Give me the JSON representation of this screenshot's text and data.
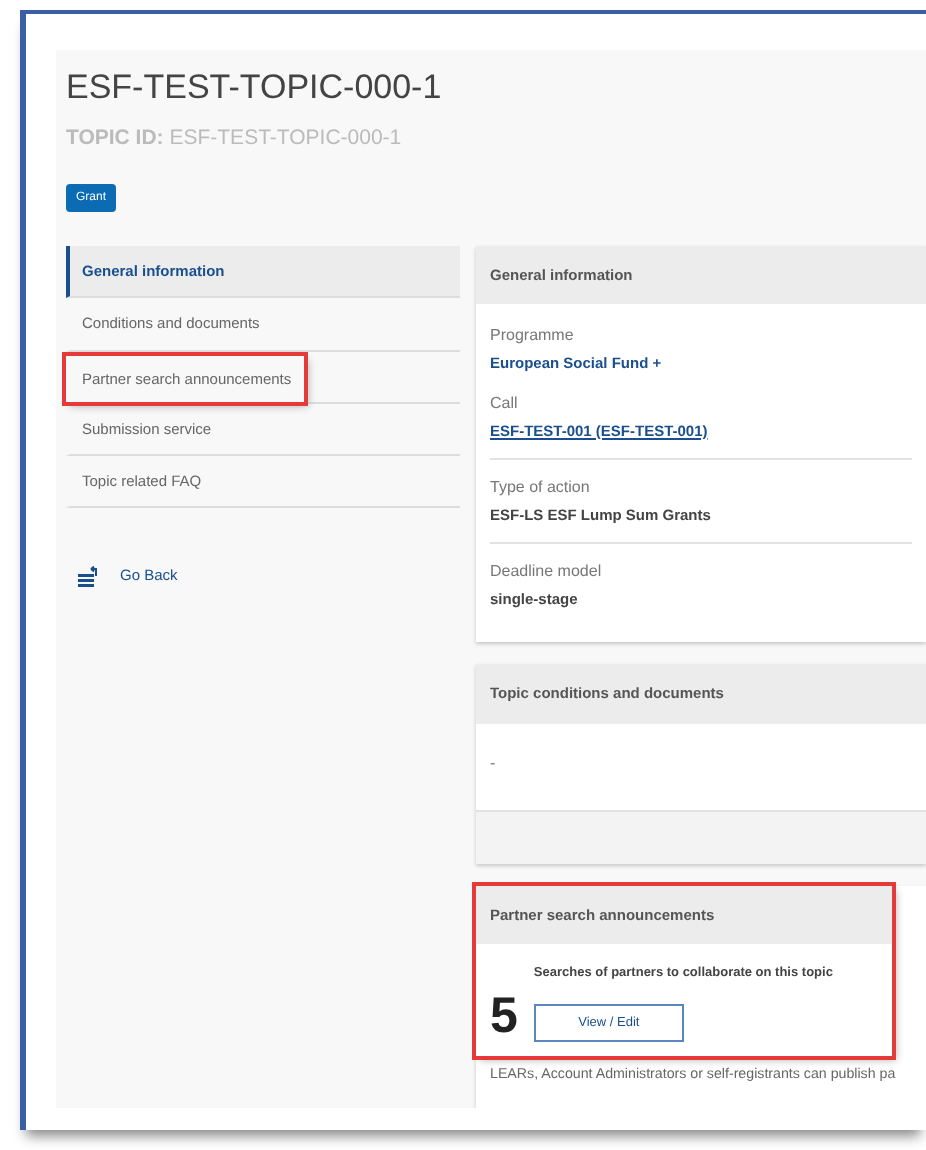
{
  "title": "ESF-TEST-TOPIC-000-1",
  "topic_id": {
    "label": "TOPIC ID:",
    "value": "ESF-TEST-TOPIC-000-1"
  },
  "badge": "Grant",
  "sidebar": {
    "items": [
      {
        "label": "General information",
        "selected": true,
        "highlighted": false
      },
      {
        "label": "Conditions and documents",
        "selected": false,
        "highlighted": false
      },
      {
        "label": "Partner search announcements",
        "selected": false,
        "highlighted": true
      },
      {
        "label": "Submission service",
        "selected": false,
        "highlighted": false
      },
      {
        "label": "Topic related FAQ",
        "selected": false,
        "highlighted": false
      }
    ],
    "back": "Go Back"
  },
  "general_information": {
    "header": "General information",
    "fields": [
      {
        "label": "Programme",
        "value": "European Social Fund +",
        "kind": "link-plain"
      },
      {
        "label": "Call",
        "value": "ESF-TEST-001 (ESF-TEST-001)",
        "kind": "link"
      },
      {
        "label": "Type of action",
        "value": "ESF-LS ESF Lump Sum Grants",
        "kind": "text"
      },
      {
        "label": "Deadline model",
        "value": "single-stage",
        "kind": "text"
      }
    ]
  },
  "conditions": {
    "header": "Topic conditions and documents",
    "body": "-"
  },
  "partner_search": {
    "header": "Partner search announcements",
    "highlighted": true,
    "count": "5",
    "description": "Searches of partners to collaborate on this topic",
    "button": "View / Edit",
    "note": "LEARs, Account Administrators or self-registrants can publish pa"
  }
}
